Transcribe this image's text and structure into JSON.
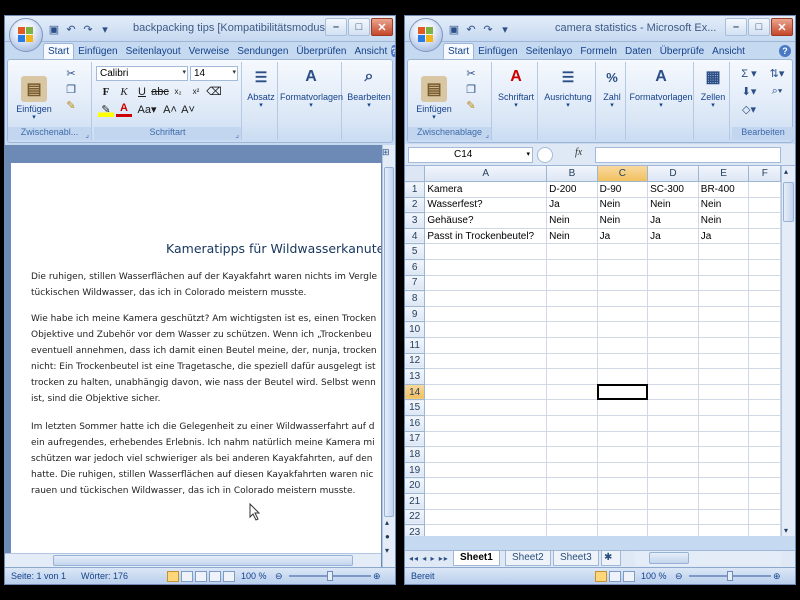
{
  "word": {
    "title": "backpacking tips [Kompatibilitätsmodus]",
    "tabs": [
      "Start",
      "Einfügen",
      "Seitenlayout",
      "Verweise",
      "Sendungen",
      "Überprüfen",
      "Ansicht"
    ],
    "groups": {
      "clipboard": "Zwischenabl...",
      "font": "Schriftart",
      "paragraph": "Absatz",
      "styles": "Formatvorlagen",
      "editing": "Bearbeiten"
    },
    "paste_label": "Einfügen",
    "font_name": "Calibri",
    "font_size": "14",
    "doc_title": "Kameratipps für Wildwasserkanuten",
    "paragraphs": [
      [
        "Die ruhigen, stillen Wasserflächen auf der Kayakfahrt waren nichts im  Vergle",
        "tückischen Wildwasser, das ich in Colorado meistern musste."
      ],
      [
        "Wie habe ich meine Kamera geschützt? Am wichtigsten ist es, einen Trocken",
        "Objektive und Zubehör vor dem Wasser zu schützen. Wenn ich „Trockenbeu",
        "eventuell annehmen, dass ich damit einen Beutel meine, der, nunja, trocken",
        "nicht: Ein Trockenbeutel ist eine Tragetasche, die speziell dafür ausgelegt ist",
        "trocken zu halten, unabhängig davon, wie nass der Beutel wird. Selbst wenn",
        "ist, sind die Objektive sicher."
      ],
      [
        "Im letzten Sommer hatte ich die Gelegenheit zu einer Wildwasserfahrt auf d",
        "ein aufregendes, erhebendes Erlebnis. Ich nahm natürlich meine Kamera mi",
        "schützen war jedoch viel schwieriger als bei anderen Kayakfahrten, auf den",
        "hatte. Die ruhigen, stillen Wasserflächen auf diesen Kayakfahrten waren nic",
        "rauen und tückischen Wildwasser, das ich in Colorado meistern musste."
      ]
    ],
    "status": {
      "page": "Seite: 1 von 1",
      "words": "Wörter: 176",
      "zoom": "100 %"
    }
  },
  "excel": {
    "title": "camera statistics - Microsoft Ex...",
    "tabs": [
      "Start",
      "Einfügen",
      "Seitenlayo",
      "Formeln",
      "Daten",
      "Überprüfe",
      "Ansicht"
    ],
    "groups": {
      "clipboard": "Zwischenablage",
      "font": "Schriftart",
      "alignment": "Ausrichtung",
      "number": "Zahl",
      "styles": "Formatvorlagen",
      "cells": "Zellen",
      "editing": "Bearbeiten"
    },
    "paste_label": "Einfügen",
    "name_box": "C14",
    "fx": "fx",
    "columns": [
      "A",
      "B",
      "C",
      "D",
      "E",
      "F"
    ],
    "selected_column": "C",
    "selected_row": 14,
    "rows": [
      [
        "Kamera",
        "D-200",
        "D-90",
        "SC-300",
        "BR-400",
        ""
      ],
      [
        "Wasserfest?",
        "Ja",
        "Nein",
        "Nein",
        "Nein",
        ""
      ],
      [
        "Gehäuse?",
        "Nein",
        "Nein",
        "Ja",
        "Nein",
        ""
      ],
      [
        "Passt in Trockenbeutel?",
        "Nein",
        "Ja",
        "Ja",
        "Ja",
        ""
      ]
    ],
    "row_count": 25,
    "sheets": [
      "Sheet1",
      "Sheet2",
      "Sheet3"
    ],
    "active_sheet": "Sheet1",
    "status": {
      "mode": "Bereit",
      "zoom": "100 %"
    }
  },
  "colors": {
    "ribbon_bg": "#dbe7f6",
    "selected_header": "#f1c15f",
    "title_text": "#17365d"
  }
}
